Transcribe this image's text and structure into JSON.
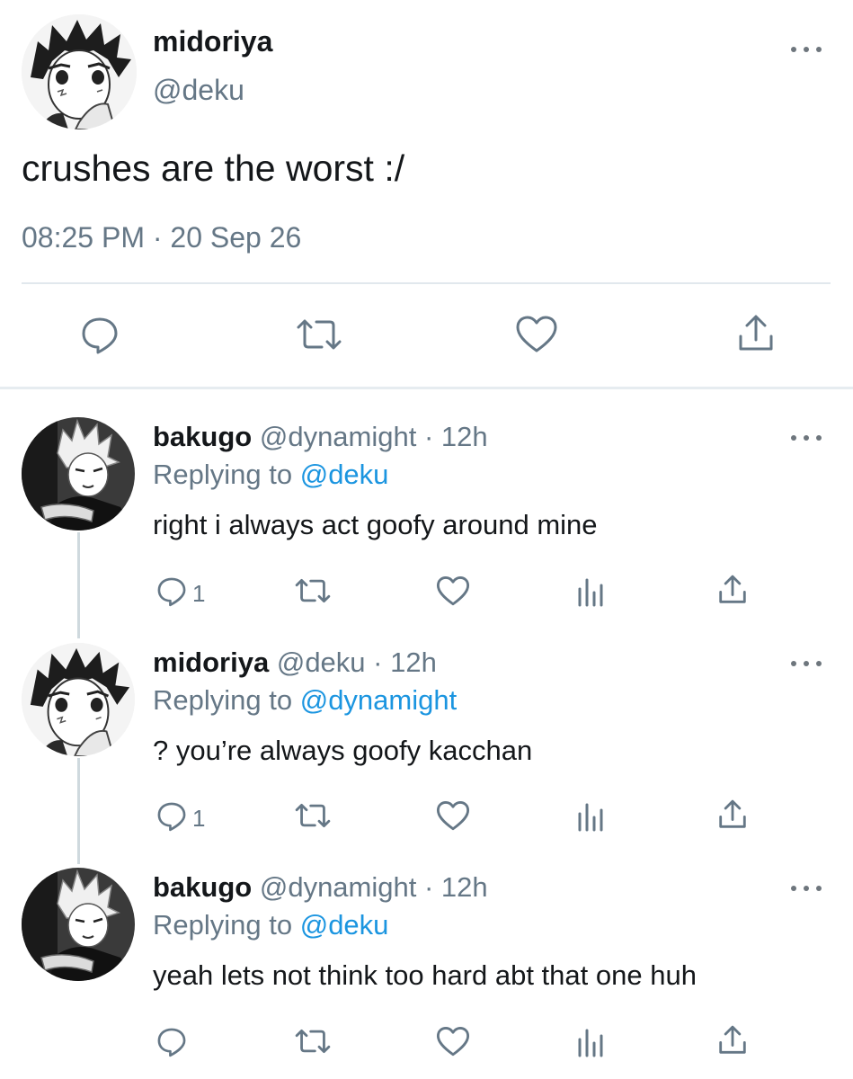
{
  "main_tweet": {
    "display_name": "midoriya",
    "handle": "@deku",
    "text": "crushes are the worst :/",
    "timestamp": "08:25 PM · 20 Sep 26",
    "actions": [
      "reply-icon",
      "retweet-icon",
      "like-icon",
      "share-icon"
    ]
  },
  "replies": [
    {
      "display_name": "bakugo",
      "handle": "@dynamight",
      "time": "12h",
      "replying_prefix": "Replying to",
      "replying_to": "@deku",
      "text": "right i always act goofy around mine",
      "reply_count": "1",
      "avatar": "avatar-bakugo"
    },
    {
      "display_name": "midoriya",
      "handle": "@deku",
      "time": "12h",
      "replying_prefix": "Replying to",
      "replying_to": "@dynamight",
      "text": "? you’re always goofy kacchan",
      "reply_count": "1",
      "avatar": "avatar-midoriya"
    },
    {
      "display_name": "bakugo",
      "handle": "@dynamight",
      "time": "12h",
      "replying_prefix": "Replying to",
      "replying_to": "@deku",
      "text": "yeah lets not think too hard abt that one huh",
      "reply_count": "",
      "avatar": "avatar-bakugo"
    }
  ],
  "separator": " · ",
  "colors": {
    "text": "#14171a",
    "secondary": "#657786",
    "link": "#1b95e0",
    "divider": "#e1e8ed",
    "thread_line": "#cfd9de"
  }
}
